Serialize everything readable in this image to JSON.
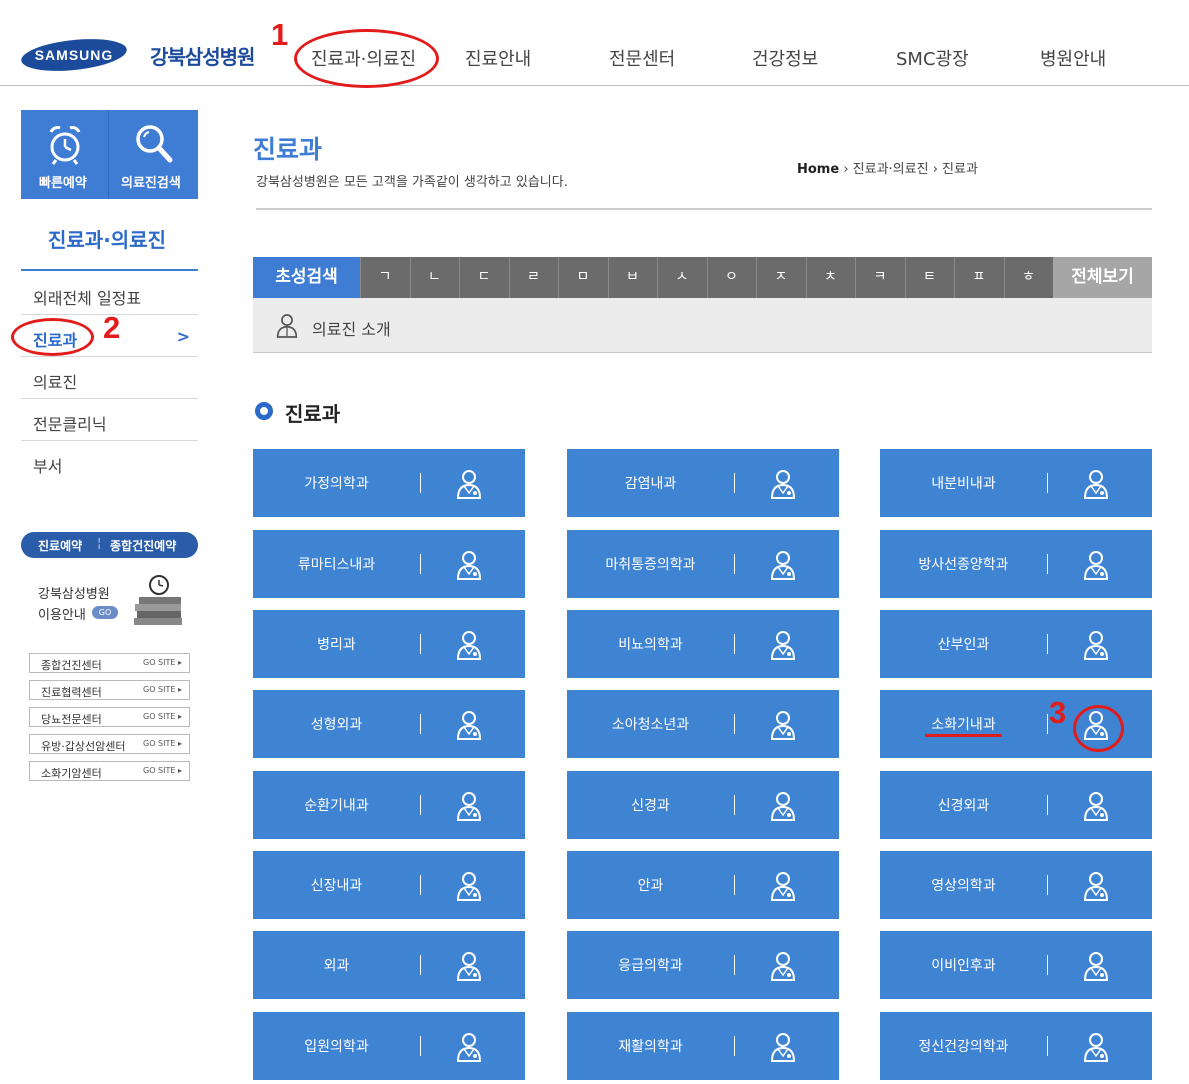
{
  "header": {
    "logo_brand": "SAMSUNG",
    "hospital_name": "강북삼성병원",
    "nav": [
      "진료과·의료진",
      "진료안내",
      "전문센터",
      "건강정보",
      "SMC광장",
      "병원안내"
    ]
  },
  "annotations": {
    "step1": "1",
    "step2": "2",
    "step3": "3"
  },
  "quick_menu": {
    "reserve": "빠른예약",
    "doctor_search": "의료진검색"
  },
  "sidebar": {
    "title": "진료과·의료진",
    "items": [
      "외래전체 일정표",
      "진료과",
      "의료진",
      "전문클리닉",
      "부서"
    ],
    "arrow": ">"
  },
  "promo": {
    "reserve": "진료예약",
    "checkup": "종합건진예약",
    "guide_line1": "강북삼성병원",
    "guide_line2": "이용안내",
    "go": "GO"
  },
  "site_links": {
    "items": [
      "종합건진센터",
      "진료협력센터",
      "당뇨전문센터",
      "유방·갑상선암센터",
      "소화기암센터"
    ],
    "go_label": "GO SITE ▸"
  },
  "page": {
    "title": "진료과",
    "subtitle": "강북삼성병원은 모든 고객을 가족같이 생각하고 있습니다.",
    "crumb_home": "Home",
    "crumb_sep": " › ",
    "crumb_1": "진료과·의료진",
    "crumb_2": "진료과"
  },
  "search": {
    "label": "초성검색",
    "keys": [
      "ㄱ",
      "ㄴ",
      "ㄷ",
      "ㄹ",
      "ㅁ",
      "ㅂ",
      "ㅅ",
      "ㅇ",
      "ㅈ",
      "ㅊ",
      "ㅋ",
      "ㅌ",
      "ㅍ",
      "ㅎ"
    ],
    "all": "전체보기"
  },
  "doctor_intro": "의료진 소개",
  "section_title": "진료과",
  "departments": [
    "가정의학과",
    "감염내과",
    "내분비내과",
    "류마티스내과",
    "마취통증의학과",
    "방사선종양학과",
    "병리과",
    "비뇨의학과",
    "산부인과",
    "성형외과",
    "소아청소년과",
    "소화기내과",
    "순환기내과",
    "신경과",
    "신경외과",
    "신장내과",
    "안과",
    "영상의학과",
    "외과",
    "응급의학과",
    "이비인후과",
    "입원의학과",
    "재활의학과",
    "정신건강의학과"
  ],
  "colors": {
    "accent": "#3f84d3",
    "annotation": "#e21b1b",
    "brand": "#1c4b9c"
  },
  "icons": {
    "department_icon": "doctor-icon",
    "quick_reserve": "alarm-clock-icon",
    "quick_search": "magnifier-icon"
  }
}
